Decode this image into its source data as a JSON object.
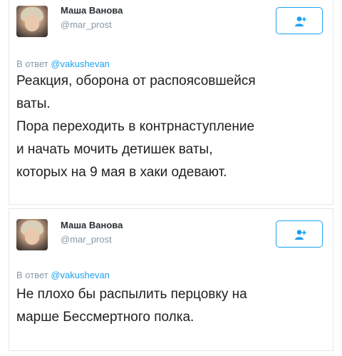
{
  "colors": {
    "accent": "#1da1f2",
    "muted": "#8899a6",
    "text": "#1f1f1f",
    "border": "#e3e6e8"
  },
  "tweets": [
    {
      "user_name": "Маша Ванова",
      "handle": "@mar_prost",
      "follow_icon": "add-user-icon",
      "reply_prefix": "В ответ",
      "reply_mention": "@vakushevan",
      "lines": [
        "Реакция, оборона от распоясовшейся",
        "ваты.",
        "Пора переходить в контрнаступление",
        "и начать мочить детишек ваты,",
        "которых на 9 мая в хаки одевают."
      ]
    },
    {
      "user_name": "Маша Ванова",
      "handle": "@mar_prost",
      "follow_icon": "add-user-icon",
      "reply_prefix": "В ответ",
      "reply_mention": "@vakushevan",
      "lines": [
        "Не плохо бы распылить перцовку на",
        "марше Бессмертного полка."
      ]
    }
  ]
}
